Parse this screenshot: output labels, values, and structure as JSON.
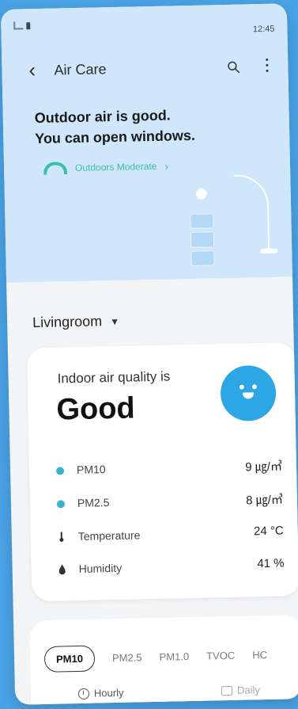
{
  "status_bar": {
    "time": "12:45"
  },
  "app": {
    "title": "Air Care"
  },
  "hero": {
    "headline_line1": "Outdoor air is good.",
    "headline_line2": "You can open windows.",
    "outdoor_status": "Outdoors Moderate"
  },
  "room": {
    "selected": "Livingroom"
  },
  "indoor": {
    "label": "Indoor air quality is",
    "value": "Good",
    "metrics": [
      {
        "label": "PM10",
        "value": "9 ㎍/㎥",
        "icon": "dot-icon"
      },
      {
        "label": "PM2.5",
        "value": "8 ㎍/㎥",
        "icon": "dot-icon"
      },
      {
        "label": "Temperature",
        "value": "24 °C",
        "icon": "thermometer-icon"
      },
      {
        "label": "Humidity",
        "value": "41 %",
        "icon": "droplet-icon"
      }
    ]
  },
  "tabs": [
    "PM10",
    "PM2.5",
    "PM1.0",
    "TVOC",
    "HC"
  ],
  "active_tab": "PM10",
  "sub_tabs": [
    "Hourly",
    "Daily"
  ],
  "colors": {
    "accent_blue": "#2ca6e4",
    "outdoor_green": "#38c1a2",
    "hero_bg": "#cfe6fb",
    "page_bg": "#4aa3e6"
  }
}
